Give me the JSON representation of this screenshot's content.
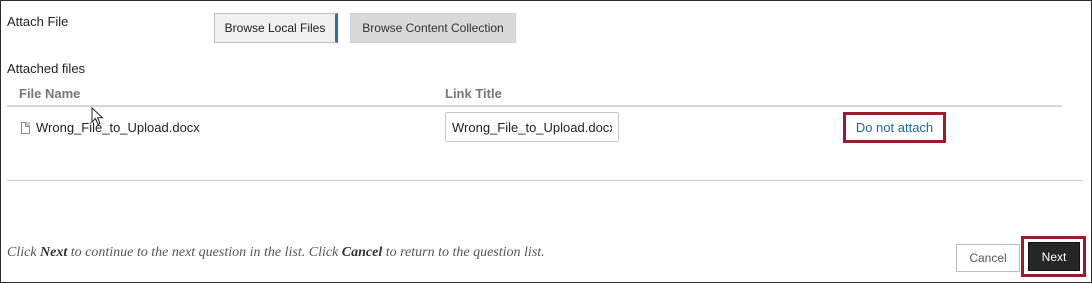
{
  "attach": {
    "label": "Attach File",
    "browse_local_label": "Browse Local Files",
    "browse_collection_label": "Browse Content Collection"
  },
  "attached_files": {
    "title": "Attached files",
    "columns": [
      "File Name",
      "Link Title"
    ],
    "rows": [
      {
        "file_icon": "document-icon",
        "file_name": "Wrong_File_to_Upload.docx",
        "link_title_value": "Wrong_File_to_Upload.docx",
        "action_label": "Do not attach"
      }
    ]
  },
  "footer": {
    "instruction_parts": [
      "Click ",
      "Next",
      " to continue to the next question in the list. Click ",
      "Cancel",
      " to return to the question list."
    ],
    "cancel_label": "Cancel",
    "next_label": "Next"
  },
  "colors": {
    "highlight_border": "#9b1c30",
    "link": "#1c6aa3",
    "primary_button": "#262626",
    "active_tab_accent": "#1f73b7"
  }
}
